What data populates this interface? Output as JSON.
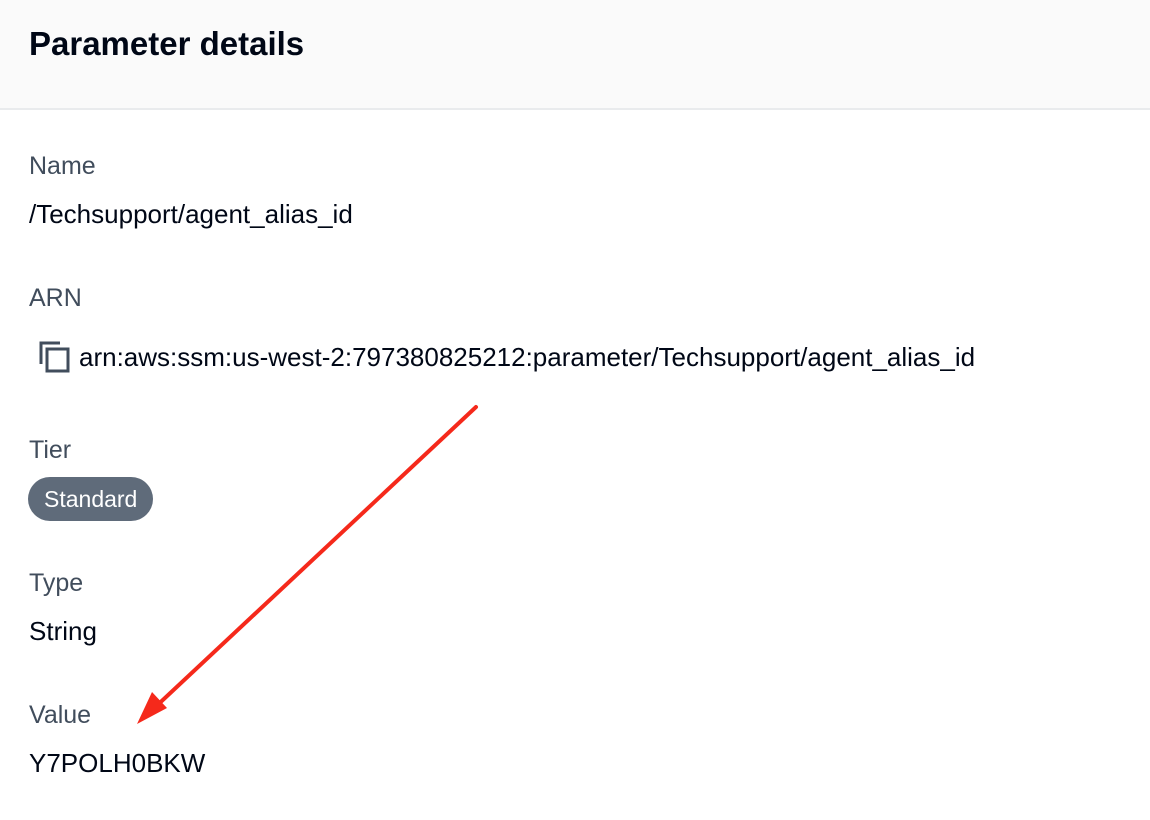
{
  "header": {
    "title": "Parameter details"
  },
  "fields": {
    "name": {
      "label": "Name",
      "value": "/Techsupport/agent_alias_id"
    },
    "arn": {
      "label": "ARN",
      "value": "arn:aws:ssm:us-west-2:797380825212:parameter/Techsupport/agent_alias_id",
      "icon": "copy-icon"
    },
    "tier": {
      "label": "Tier",
      "value": "Standard"
    },
    "type": {
      "label": "Type",
      "value": "String"
    },
    "value": {
      "label": "Value",
      "value": "Y7POLH0BKW"
    }
  },
  "colors": {
    "header_bg": "#fafafa",
    "label": "#414d5c",
    "text": "#000716",
    "badge_bg": "#5f6b7a",
    "annotation_arrow": "#f5291b"
  },
  "annotation": {
    "icon": "arrow-annotation"
  }
}
